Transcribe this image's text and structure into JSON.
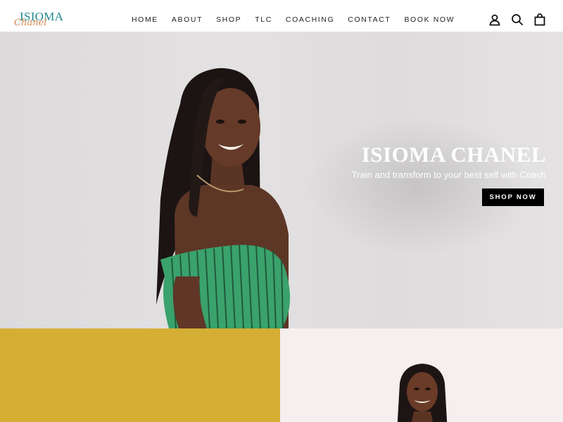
{
  "header": {
    "logo": {
      "main": "ISIOMA",
      "script": "Chanel"
    },
    "nav": [
      {
        "label": "HOME"
      },
      {
        "label": "ABOUT"
      },
      {
        "label": "SHOP"
      },
      {
        "label": "TLC"
      },
      {
        "label": "COACHING"
      },
      {
        "label": "CONTACT"
      },
      {
        "label": "BOOK NOW"
      }
    ],
    "icons": [
      "account-icon",
      "search-icon",
      "cart-icon"
    ]
  },
  "hero": {
    "title": "ISIOMA CHANEL",
    "subtitle": "Train and transform to your best self with Coach",
    "button_label": "SHOP NOW"
  },
  "sections": {
    "yellow_color": "#d4af33",
    "pink_color": "#f6eff0"
  },
  "colors": {
    "logo_teal": "#1f8a8f",
    "logo_orange": "#d6874e",
    "button_bg": "#000000",
    "top_dress_green": "#3aa26c"
  }
}
